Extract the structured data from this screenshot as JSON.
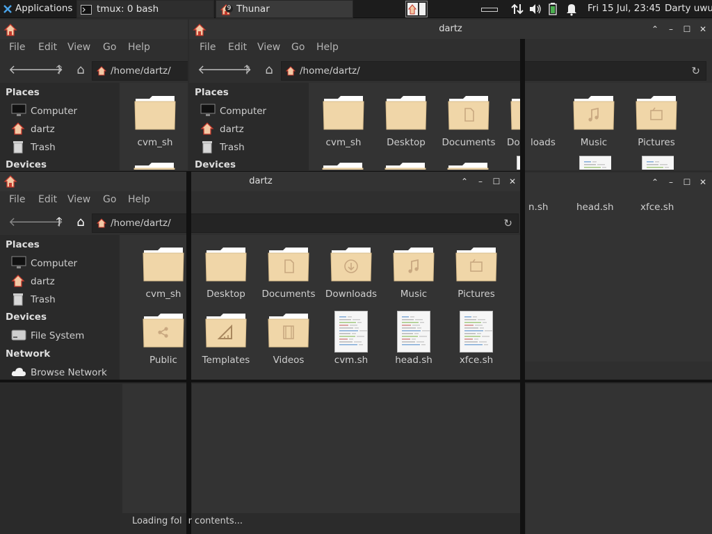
{
  "panel": {
    "applications": "Applications",
    "tasks": [
      {
        "label": "tmux: 0 bash"
      },
      {
        "label": "Thunar",
        "badge": "9"
      }
    ],
    "clock": "Fri 15 Jul, 23:45",
    "user": "Darty uwu"
  },
  "window": {
    "title": "dartz",
    "menu": [
      "File",
      "Edit",
      "View",
      "Go",
      "Help"
    ],
    "path": "/home/dartz/"
  },
  "sidebar": {
    "places_header": "Places",
    "places": [
      "Computer",
      "dartz",
      "Trash"
    ],
    "devices_header": "Devices",
    "devices": [
      "File System"
    ],
    "network_header": "Network",
    "network": [
      "Browse Network"
    ]
  },
  "files": [
    {
      "name": "cvm_sh",
      "type": "folder"
    },
    {
      "name": "Desktop",
      "type": "folder"
    },
    {
      "name": "Documents",
      "type": "folder-doc"
    },
    {
      "name": "Downloads",
      "type": "folder-download"
    },
    {
      "name": "Music",
      "type": "folder-music"
    },
    {
      "name": "Pictures",
      "type": "folder-pictures"
    },
    {
      "name": "Public",
      "type": "folder-share"
    },
    {
      "name": "Templates",
      "type": "folder-templates"
    },
    {
      "name": "Videos",
      "type": "folder-video"
    },
    {
      "name": "cvm.sh",
      "type": "script"
    },
    {
      "name": "head.sh",
      "type": "script"
    },
    {
      "name": "xfce.sh",
      "type": "script"
    }
  ],
  "back_files": {
    "partial_download": "Do",
    "partial_download_rest": "loads",
    "cut_cvm": "n.sh"
  },
  "status": "Loading fol",
  "status_rest": "r contents...",
  "colors": {
    "folder": "#f0d6a8",
    "folder_tab": "#ffffff",
    "accent": "#e2a27a"
  }
}
